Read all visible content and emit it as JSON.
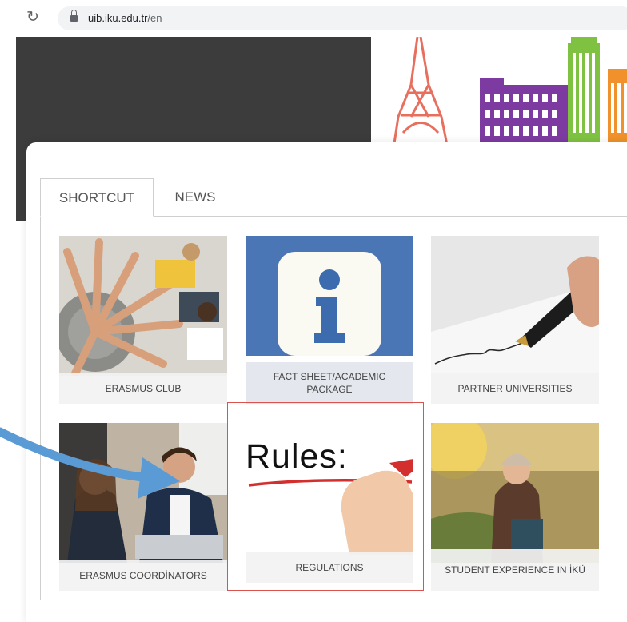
{
  "browser": {
    "reload_icon": "reload-icon",
    "lock_icon": "lock-icon",
    "url_host": "uib.iku.edu.tr",
    "url_path": "/en"
  },
  "tabs": [
    {
      "label": "SHORTCUT",
      "active": true
    },
    {
      "label": "NEWS",
      "active": false
    }
  ],
  "tiles": [
    {
      "label": "ERASMUS CLUB"
    },
    {
      "label": "FACT SHEET/ACADEMIC PACKAGE"
    },
    {
      "label": "PARTNER UNIVERSITIES"
    },
    {
      "label": "ERASMUS COORDİNATORS"
    },
    {
      "label": "REGULATIONS",
      "image_text": "Rules:"
    },
    {
      "label": "STUDENT EXPERIENCE IN İKÜ"
    }
  ],
  "colors": {
    "highlight_border": "#d9534f",
    "annotation_arrow": "#5b9bd5",
    "info_tile_blue": "#4b76b6"
  }
}
